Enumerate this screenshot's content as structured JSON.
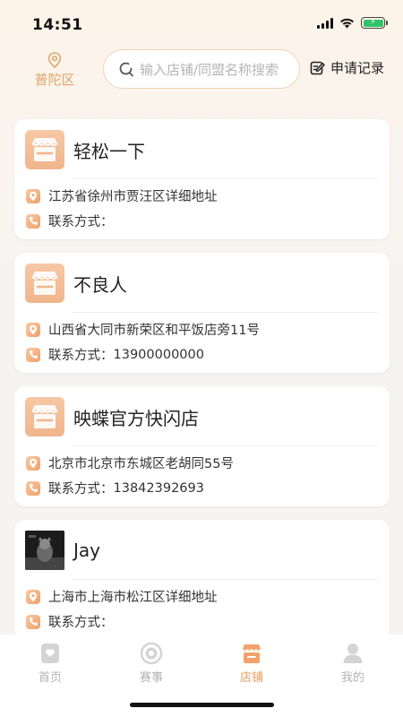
{
  "status_bar": {
    "time": "14:51"
  },
  "header": {
    "district": "普陀区",
    "search_placeholder": "输入店铺/同盟名称搜索",
    "apply_label": "申请记录"
  },
  "stores": [
    {
      "name": "轻松一下",
      "logo": "store-icon",
      "address": "江苏省徐州市贾汪区详细地址",
      "phone_label": "联系方式：",
      "phone": ""
    },
    {
      "name": "不良人",
      "logo": "store-icon",
      "address": "山西省大同市新荣区和平饭店旁11号",
      "phone_label": "联系方式：",
      "phone": "13900000000"
    },
    {
      "name": "映蝶官方快闪店",
      "logo": "store-icon",
      "address": "北京市北京市东城区老胡同55号",
      "phone_label": "联系方式：",
      "phone": "13842392693"
    },
    {
      "name": "Jay",
      "logo": "photo",
      "address": "上海市上海市松江区详细地址",
      "phone_label": "联系方式：",
      "phone": ""
    }
  ],
  "tabs": [
    {
      "label": "首页",
      "icon": "heart-card-icon",
      "active": false
    },
    {
      "label": "赛事",
      "icon": "target-icon",
      "active": false
    },
    {
      "label": "店铺",
      "icon": "store-icon",
      "active": true
    },
    {
      "label": "我的",
      "icon": "person-icon",
      "active": false
    }
  ],
  "colors": {
    "accent": "#e79b5c",
    "accent_light": "#f6c8a6",
    "inactive": "#b3b3b3"
  }
}
